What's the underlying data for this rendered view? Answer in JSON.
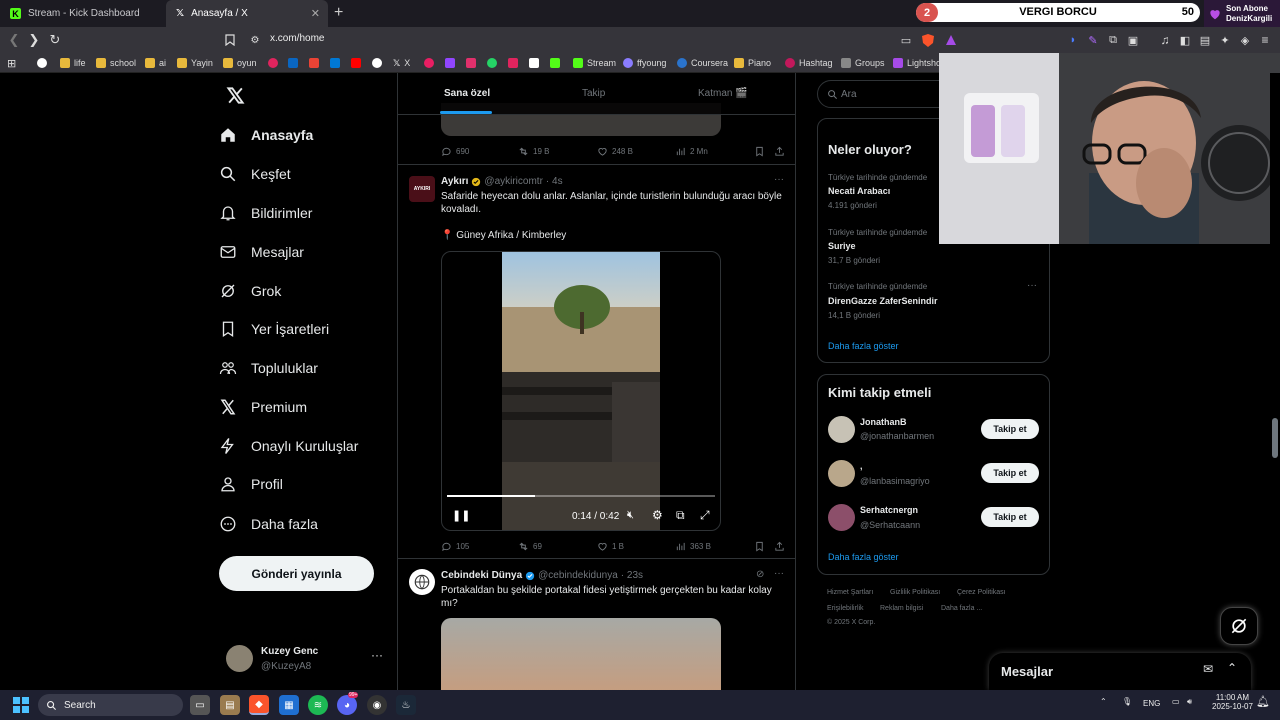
{
  "browser": {
    "tabs": [
      {
        "title": "Stream - Kick Dashboard",
        "active": false
      },
      {
        "title": "Anasayfa / X",
        "active": true
      }
    ],
    "url": "x.com/home",
    "bookmarks": [
      "life",
      "school",
      "ai",
      "Yayin",
      "oyun",
      "X",
      "Stream",
      "ffyoung",
      "Coursera",
      "Piano",
      "Hashtag",
      "Groups",
      "Lightshot"
    ]
  },
  "stream_overlay": {
    "left_number": "2",
    "title": "VERGI BORCU",
    "right_number": "50",
    "subscriber_label": "Son Abone",
    "subscriber_name": "DenizKargili"
  },
  "sidebar": {
    "items": [
      {
        "label": "Anasayfa",
        "icon": "home-icon"
      },
      {
        "label": "Keşfet",
        "icon": "search-icon"
      },
      {
        "label": "Bildirimler",
        "icon": "bell-icon"
      },
      {
        "label": "Mesajlar",
        "icon": "mail-icon"
      },
      {
        "label": "Grok",
        "icon": "grok-icon"
      },
      {
        "label": "Yer İşaretleri",
        "icon": "bookmark-icon"
      },
      {
        "label": "Topluluklar",
        "icon": "communities-icon"
      },
      {
        "label": "Premium",
        "icon": "x-logo-icon"
      },
      {
        "label": "Onaylı Kuruluşlar",
        "icon": "lightning-icon"
      },
      {
        "label": "Profil",
        "icon": "person-icon"
      },
      {
        "label": "Daha fazla",
        "icon": "more-circle-icon"
      }
    ],
    "post_button": "Gönderi yayınla",
    "account": {
      "name": "Kuzey Genc",
      "handle": "@KuzeyA8"
    }
  },
  "feed": {
    "tabs": [
      "Sana özel",
      "Takip",
      "Katman 🎬"
    ],
    "prev_tweet_stats": {
      "replies": "690",
      "reposts": "19 B",
      "likes": "248 B",
      "views": "2 Mn"
    },
    "tweet1": {
      "name": "Aykırı",
      "handle": "@aykiricomtr",
      "time": "· 4s",
      "avatar_text": "AYKIRI",
      "text": "Safaride heyecan dolu anlar. Aslanlar, içinde turistlerin bulunduğu aracı böyle kovaladı.",
      "location": "📍 Güney Afrika / Kimberley",
      "video_time": "0:14 / 0:42",
      "video_progress": 0.33,
      "stats": {
        "replies": "105",
        "reposts": "69",
        "likes": "1 B",
        "views": "363 B"
      }
    },
    "tweet2": {
      "name": "Cebindeki Dünya",
      "handle": "@cebindekidunya",
      "time": "· 23s",
      "text": "Portakaldan bu şekilde portakal fidesi yetiştirmek gerçekten bu kadar kolay mı?"
    }
  },
  "right": {
    "search_placeholder": "Ara",
    "trends_title": "Neler oluyor?",
    "trends": [
      {
        "meta": "Türkiye tarihinde gündemde",
        "name": "Necati Arabacı",
        "count": "4.191 gönderi"
      },
      {
        "meta": "Türkiye tarihinde gündemde",
        "name": "Suriye",
        "count": "31,7 B gönderi"
      },
      {
        "meta": "Türkiye tarihinde gündemde",
        "name": "DirenGazze ZaferSenindir",
        "count": "14,1 B gönderi"
      }
    ],
    "trends_more": "Daha fazla göster",
    "follow_title": "Kimi takip etmeli",
    "follow": [
      {
        "name": "JonathanB",
        "handle": "@jonathanbarmen",
        "button": "Takip et"
      },
      {
        "name": ",",
        "handle": "@lanbasimagriyo",
        "button": "Takip et"
      },
      {
        "name": "Serhatcnergn",
        "handle": "@Serhatcaann",
        "button": "Takip et"
      }
    ],
    "follow_more": "Daha fazla göster",
    "footer_links": [
      "Hizmet Şartları",
      "Gizlilik Politikası",
      "Çerez Politikası",
      "Erişilebilirlik",
      "Reklam bilgisi",
      "Daha fazla ..."
    ],
    "copyright": "© 2025 X Corp.",
    "messages_title": "Mesajlar"
  },
  "taskbar": {
    "search": "Search",
    "lang": "ENG",
    "time": "11:00 AM",
    "date": "2025-10-07",
    "discord_badge": "99+"
  }
}
